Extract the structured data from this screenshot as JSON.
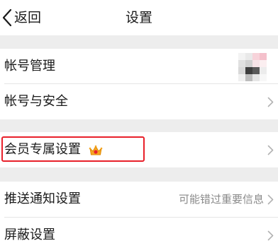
{
  "header": {
    "back_label": "返回",
    "title": "设置"
  },
  "groups": [
    {
      "rows": [
        {
          "label": "帐号管理",
          "has_avatar_mosaic": true
        },
        {
          "label": "帐号与安全"
        }
      ]
    },
    {
      "rows": [
        {
          "label": "会员专属设置",
          "badge_icon": "vip-crown-icon",
          "highlighted": true
        }
      ]
    },
    {
      "rows": [
        {
          "label": "推送通知设置",
          "value": "可能错过重要信息"
        },
        {
          "label": "屏蔽设置"
        }
      ]
    }
  ],
  "colors": {
    "background": "#ededed",
    "highlight_border": "#e8202a",
    "secondary_text": "#8a8a8a"
  }
}
